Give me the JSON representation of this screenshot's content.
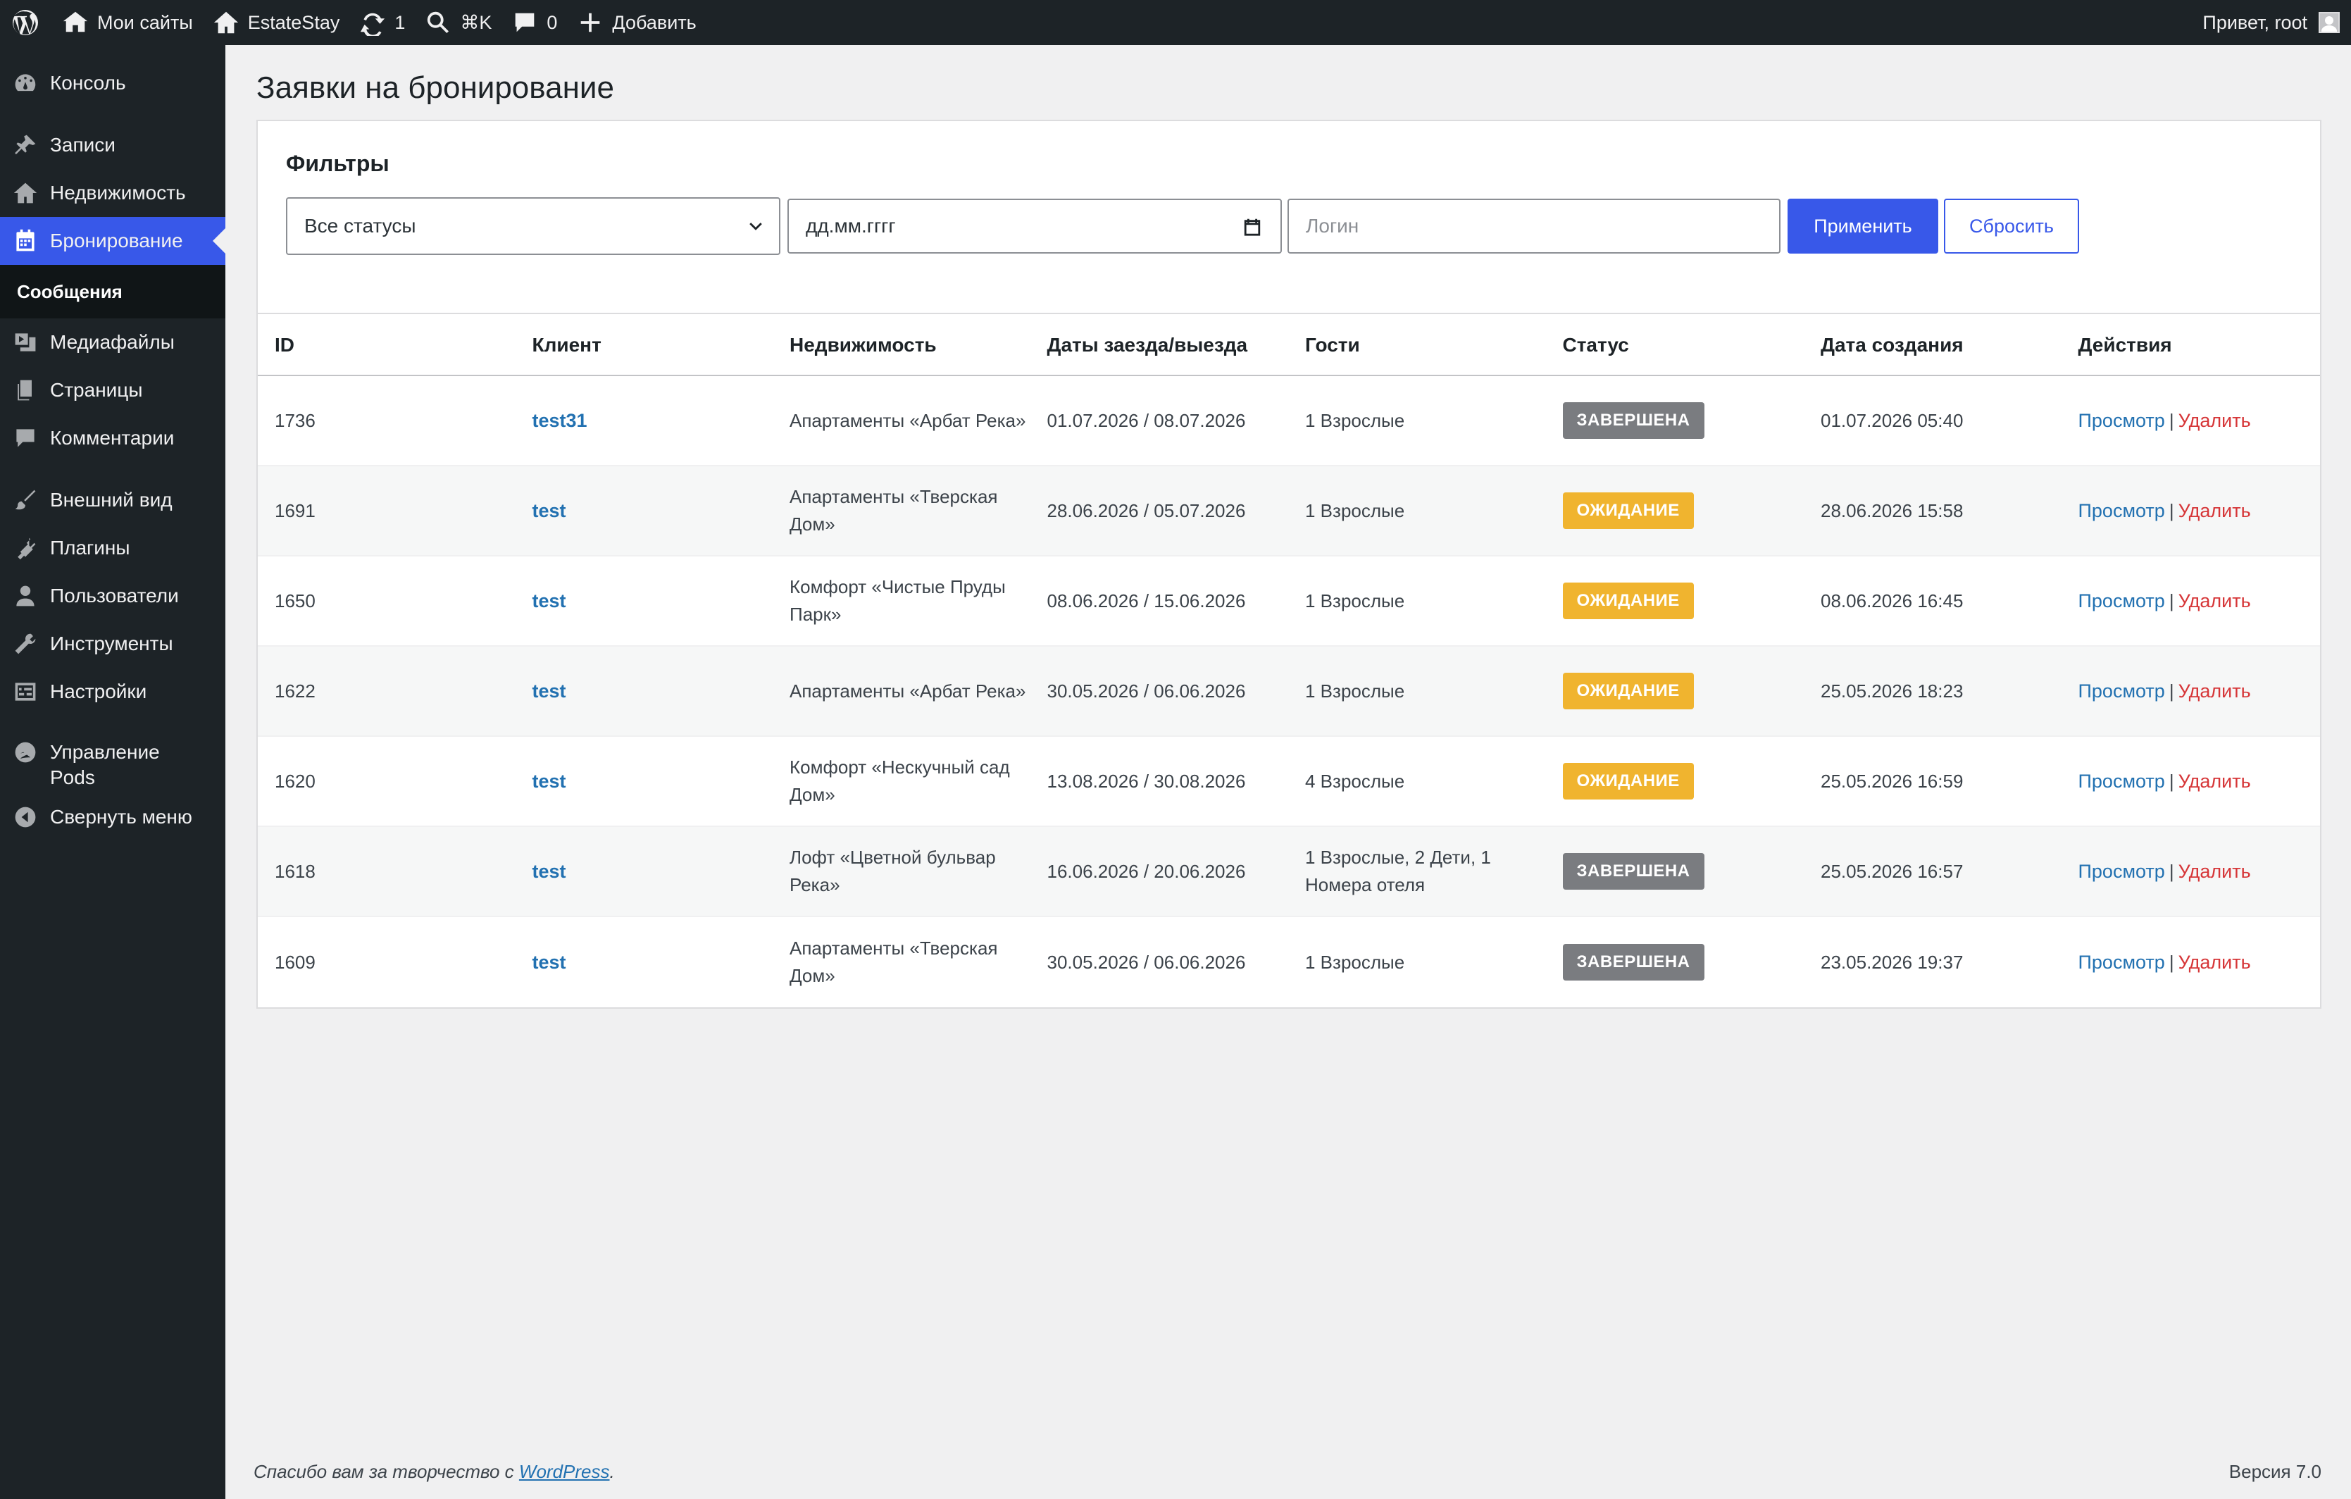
{
  "adminbar": {
    "my_sites": "Мои сайты",
    "site_name": "EstateStay",
    "updates": "1",
    "search_shortcut": "⌘K",
    "comments": "0",
    "add_new": "Добавить",
    "greeting": "Привет, root"
  },
  "sidebar": {
    "items": [
      {
        "label": "Консоль",
        "icon": "dashboard-icon"
      },
      {
        "label": "Записи",
        "icon": "pin-icon"
      },
      {
        "label": "Недвижимость",
        "icon": "home-icon"
      },
      {
        "label": "Бронирование",
        "icon": "calendar-icon"
      },
      {
        "label": "Медиафайлы",
        "icon": "media-icon"
      },
      {
        "label": "Страницы",
        "icon": "pages-icon"
      },
      {
        "label": "Комментарии",
        "icon": "comment-icon"
      },
      {
        "label": "Внешний вид",
        "icon": "brush-icon"
      },
      {
        "label": "Плагины",
        "icon": "plugin-icon"
      },
      {
        "label": "Пользователи",
        "icon": "user-icon"
      },
      {
        "label": "Инструменты",
        "icon": "wrench-icon"
      },
      {
        "label": "Настройки",
        "icon": "settings-icon"
      },
      {
        "label": "Управление\nPods",
        "icon": "pods-icon"
      },
      {
        "label": "Свернуть меню",
        "icon": "collapse-icon"
      }
    ],
    "submenu_label": "Сообщения"
  },
  "page": {
    "title": "Заявки на бронирование"
  },
  "filters": {
    "heading": "Фильтры",
    "status_value": "Все статусы",
    "date_placeholder": "дд.мм.гггг",
    "login_placeholder": "Логин",
    "apply_label": "Применить",
    "reset_label": "Сбросить"
  },
  "table": {
    "headers": [
      "ID",
      "Клиент",
      "Недвижимость",
      "Даты заезда/выезда",
      "Гости",
      "Статус",
      "Дата создания",
      "Действия"
    ],
    "view_label": "Просмотр",
    "delete_label": "Удалить",
    "rows": [
      {
        "id": "1736",
        "client": "test31",
        "property": "Апартаменты «Арбат Река»",
        "dates": "01.07.2026 / 08.07.2026",
        "guests": "1 Взрослые",
        "status": "ЗАВЕРШЕНА",
        "status_type": "done",
        "created": "01.07.2026 05:40"
      },
      {
        "id": "1691",
        "client": "test",
        "property": "Апартаменты «Тверская Дом»",
        "dates": "28.06.2026 / 05.07.2026",
        "guests": "1 Взрослые",
        "status": "ОЖИДАНИЕ",
        "status_type": "wait",
        "created": "28.06.2026 15:58"
      },
      {
        "id": "1650",
        "client": "test",
        "property": "Комфорт «Чистые Пруды Парк»",
        "dates": "08.06.2026 / 15.06.2026",
        "guests": "1 Взрослые",
        "status": "ОЖИДАНИЕ",
        "status_type": "wait",
        "created": "08.06.2026 16:45"
      },
      {
        "id": "1622",
        "client": "test",
        "property": "Апартаменты «Арбат Река»",
        "dates": "30.05.2026 / 06.06.2026",
        "guests": "1 Взрослые",
        "status": "ОЖИДАНИЕ",
        "status_type": "wait",
        "created": "25.05.2026 18:23"
      },
      {
        "id": "1620",
        "client": "test",
        "property": "Комфорт «Нескучный сад Дом»",
        "dates": "13.08.2026 / 30.08.2026",
        "guests": "4 Взрослые",
        "status": "ОЖИДАНИЕ",
        "status_type": "wait",
        "created": "25.05.2026 16:59"
      },
      {
        "id": "1618",
        "client": "test",
        "property": "Лофт «Цветной бульвар Река»",
        "dates": "16.06.2026 / 20.06.2026",
        "guests": "1 Взрослые, 2 Дети, 1 Номера отеля",
        "status": "ЗАВЕРШЕНА",
        "status_type": "done",
        "created": "25.05.2026 16:57"
      },
      {
        "id": "1609",
        "client": "test",
        "property": "Апартаменты «Тверская Дом»",
        "dates": "30.05.2026 / 06.06.2026",
        "guests": "1 Взрослые",
        "status": "ЗАВЕРШЕНА",
        "status_type": "done",
        "created": "23.05.2026 19:37"
      }
    ]
  },
  "footer": {
    "thanks_prefix": "Спасибо вам за творчество с ",
    "wp_link": "WordPress",
    "thanks_suffix": ".",
    "version": "Версия 7.0"
  },
  "colors": {
    "accent": "#3858e9",
    "link": "#2271b1",
    "delete": "#d63638",
    "badge_done": "#7a7c80",
    "badge_wait": "#f0b42f"
  }
}
